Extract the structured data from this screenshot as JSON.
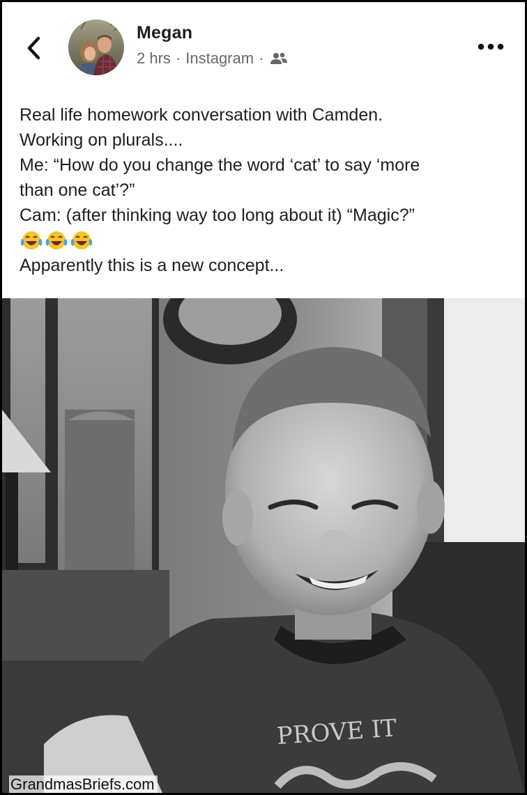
{
  "post": {
    "author": "Megan",
    "time": "2 hrs",
    "source": "Instagram",
    "separator": "·",
    "audience_icon": "friends-icon",
    "back_icon": "chevron-left-icon",
    "more_icon": "more-dots-icon",
    "text_lines": [
      "Real life homework conversation with Camden.",
      "Working on plurals....",
      "Me: “How do you change the word ‘cat’ to say ‘more",
      "than one cat’?”",
      "Cam: (after thinking way too long about it) “Magic?”"
    ],
    "emoji": [
      "😂",
      "😂",
      "😂"
    ],
    "last_line": "Apparently this is a new concept...",
    "photo_shirt_text": "PROVE IT"
  },
  "watermark": "GrandmasBriefs.com",
  "colors": {
    "text": "#1c1e21",
    "meta": "#65676b",
    "background": "#ffffff"
  }
}
